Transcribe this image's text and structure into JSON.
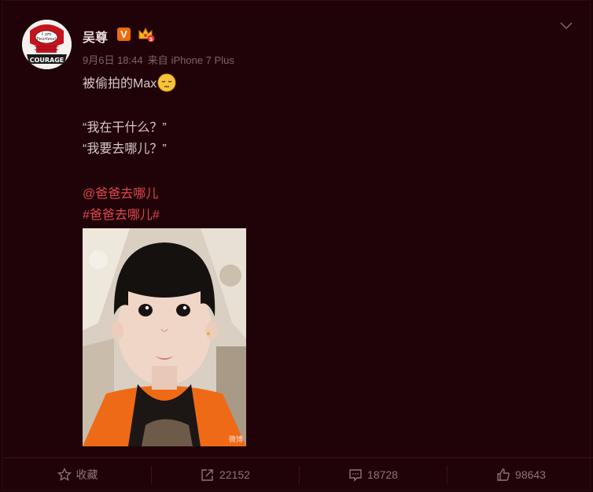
{
  "post": {
    "username": "吴尊",
    "verified_badge": "V",
    "member_badge": "crown-badge-icon",
    "avatar": {
      "line1": "I am",
      "line2": "Fearless!",
      "banner": "COURAGE"
    },
    "timestamp": "9月6日 18:44",
    "source_prefix": "来自",
    "source_device": "iPhone 7 Plus",
    "body": {
      "line1": "被偷拍的Max",
      "line2": "“我在干什么？”",
      "line3": "“我要去哪儿？”",
      "mention": "@爸爸去哪儿",
      "hashtag": "#爸爸去哪儿#"
    },
    "photo_watermark": "微博"
  },
  "toolbar": {
    "favorite_label": "收藏",
    "repost_count": "22152",
    "comment_count": "18728",
    "like_count": "98643"
  },
  "colors": {
    "background": "#1f0308",
    "link": "#e2474f",
    "text": "#d8c8cc",
    "muted": "#7a646a",
    "verified": "#ef6a0c"
  }
}
